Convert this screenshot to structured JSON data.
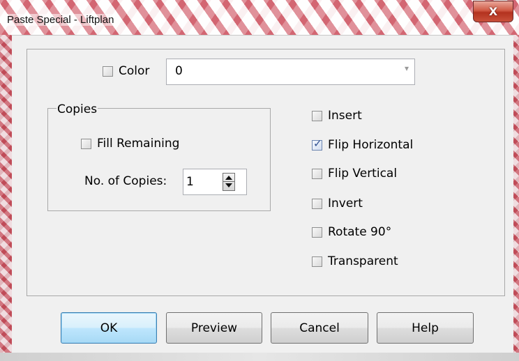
{
  "window": {
    "title": "Paste Special - Liftplan",
    "close_glyph": "X"
  },
  "color": {
    "checkbox_label": "Color",
    "checked": false,
    "combo_value": "0",
    "combo_arrow": "▾"
  },
  "copies": {
    "group_label": "Copies",
    "fill_remaining_label": "Fill Remaining",
    "fill_remaining_checked": false,
    "count_label": "No. of Copies:",
    "count_value": "1"
  },
  "options": [
    {
      "label": "Insert",
      "checked": false
    },
    {
      "label": "Flip Horizontal",
      "checked": true
    },
    {
      "label": "Flip Vertical",
      "checked": false
    },
    {
      "label": "Invert",
      "checked": false
    },
    {
      "label": "Rotate 90°",
      "checked": false
    },
    {
      "label": "Transparent",
      "checked": false
    }
  ],
  "buttons": {
    "ok": "OK",
    "preview": "Preview",
    "cancel": "Cancel",
    "help": "Help"
  },
  "icons": {
    "close": "close-icon",
    "check": "checkmark-icon",
    "dropdown": "chevron-down-icon",
    "spin_up": "arrow-up-icon",
    "spin_down": "arrow-down-icon"
  },
  "colors": {
    "accent_default_button": "#3c7fb1",
    "close_button": "#c9503a",
    "dialog_background": "#f0f0f0",
    "frame_pattern": "#be2837"
  }
}
